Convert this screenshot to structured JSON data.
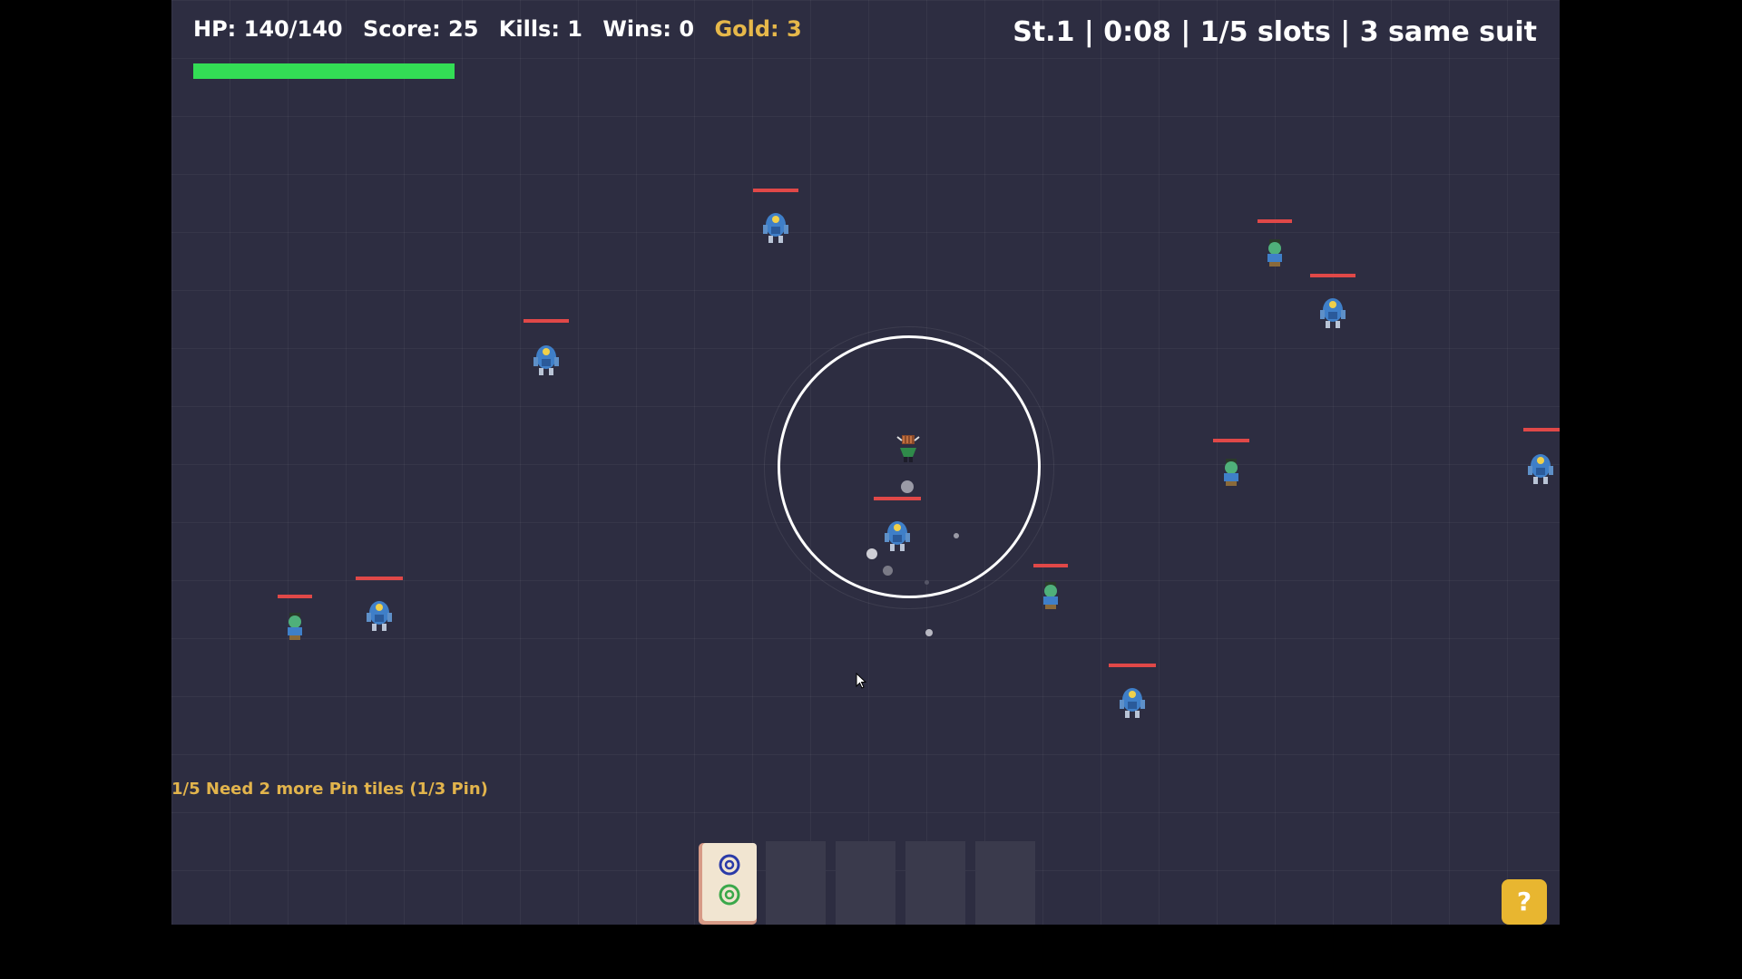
{
  "hud": {
    "hp": "HP: 140/140",
    "score": "Score: 25",
    "kills": "Kills: 1",
    "wins": "Wins: 0",
    "gold": "Gold: 3",
    "hp_fraction": 1.0,
    "stage_info": "St.1 | 0:08 | 1/5 slots | 3 same suit"
  },
  "status_line": "1/5  Need 2 more Pin tiles  (1/3 Pin)",
  "tile_slots": {
    "total": 5,
    "filled": 1,
    "tiles": [
      {
        "suit": "pin",
        "icon": "two-circles-tile-icon"
      }
    ]
  },
  "help_button": {
    "label": "?"
  },
  "colors": {
    "background": "#2d2d41",
    "hp_bar": "#33dd55",
    "gold": "#e6b84a",
    "enemy_health": "#e04848",
    "help_button": "#e8b630"
  }
}
